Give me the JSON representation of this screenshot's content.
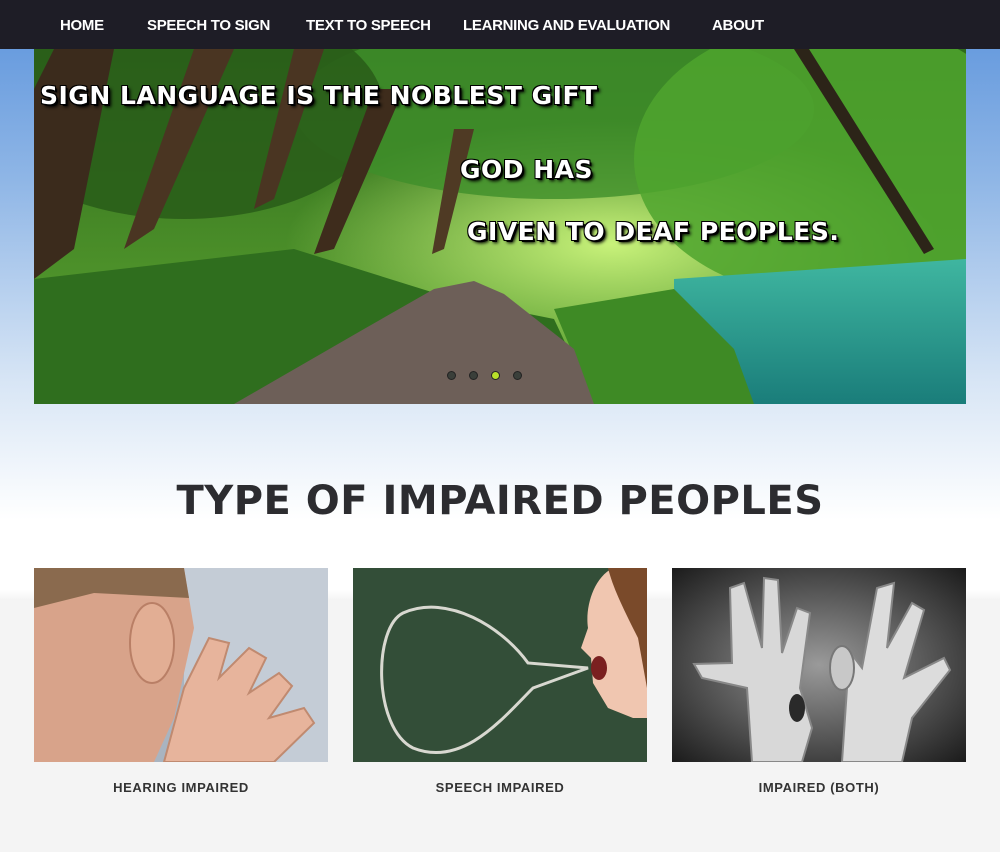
{
  "nav": {
    "items": [
      {
        "label": "HOME"
      },
      {
        "label": "SPEECH TO SIGN"
      },
      {
        "label": "TEXT TO SPEECH"
      },
      {
        "label": "LEARNING AND EVALUATION"
      },
      {
        "label": "ABOUT"
      }
    ]
  },
  "hero": {
    "line1": "SIGN LANGUAGE IS THE NOBLEST GIFT",
    "line2": "GOD HAS",
    "line3": "GIVEN TO DEAF PEOPLES.",
    "slide_count": 4,
    "active_slide": 3
  },
  "section": {
    "title": "TYPE OF IMPAIRED PEOPLES"
  },
  "cards": [
    {
      "caption": "HEARING IMPAIRED",
      "image": "ear-hand-photo"
    },
    {
      "caption": "SPEECH IMPAIRED",
      "image": "girl-speech-bubble-photo"
    },
    {
      "caption": "IMPAIRED (BOTH)",
      "image": "hands-ear-mouth-photo"
    }
  ],
  "colors": {
    "navbar": "#1e1d26",
    "active_dot": "#b8e02a",
    "title": "#2c2c30"
  }
}
